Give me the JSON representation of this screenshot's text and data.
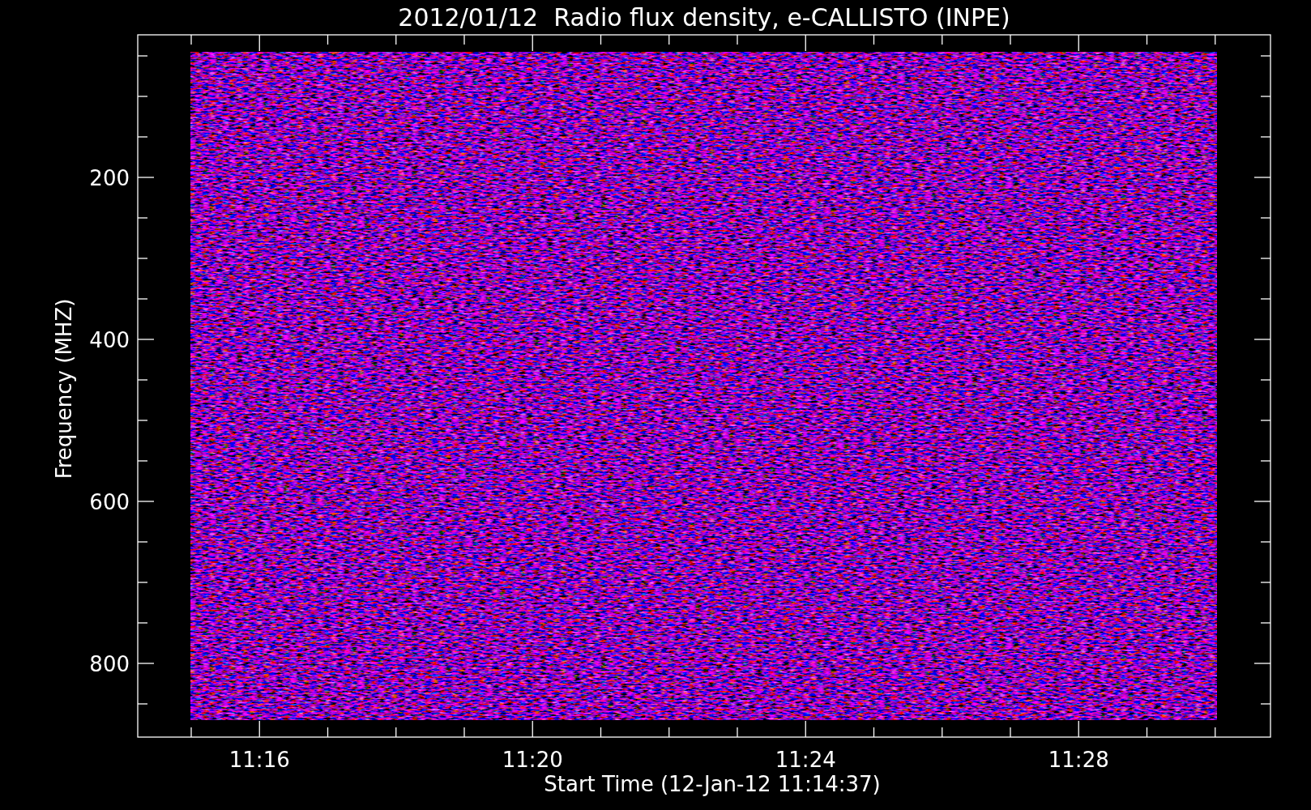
{
  "chart": {
    "title": "2012/01/12  Radio flux density, e-CALLISTO (INPE)",
    "xlabel": "Start Time (12-Jan-12 11:14:37)",
    "ylabel": "Frequency (MHZ)",
    "ytick_labels": [
      "200",
      "400",
      "600",
      "800"
    ],
    "xtick_labels": [
      "11:16",
      "11:20",
      "11:24",
      "11:28"
    ]
  }
}
